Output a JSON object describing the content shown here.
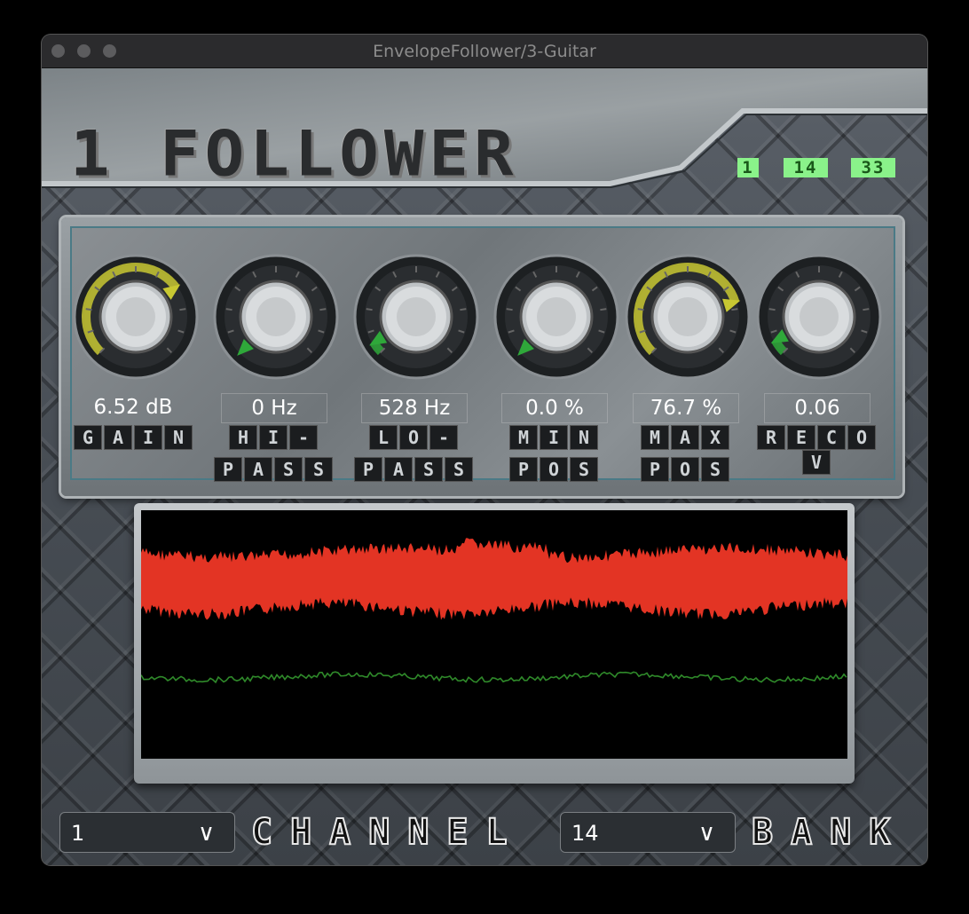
{
  "window": {
    "title": "EnvelopeFollower/3-Guitar"
  },
  "header": {
    "logo": "1 FOLLOWER",
    "lcd": [
      "1",
      "14",
      "33"
    ]
  },
  "knobs": [
    {
      "value": "6.52 dB",
      "label": [
        "GAIN"
      ],
      "level": 0.7,
      "color": "#c8c832"
    },
    {
      "value": "0 Hz",
      "label": [
        "HI-",
        "PASS"
      ],
      "level": 0.0,
      "color": "#2fa83a"
    },
    {
      "value": "528 Hz",
      "label": [
        "LO-",
        "PASS"
      ],
      "level": 0.05,
      "color": "#2fa83a"
    },
    {
      "value": "0.0 %",
      "label": [
        "MIN",
        "POS"
      ],
      "level": 0.0,
      "color": "#2fa83a"
    },
    {
      "value": "76.7 %",
      "label": [
        "MAX",
        "POS"
      ],
      "level": 0.77,
      "color": "#c8c832"
    },
    {
      "value": "0.06",
      "label": [
        "RECOV"
      ],
      "level": 0.06,
      "color": "#2fa83a"
    }
  ],
  "bottom": {
    "channel_value": "1",
    "channel_label": "CHANNEL",
    "bank_value": "14",
    "bank_label": "BANK"
  },
  "colors": {
    "signal": "#e33424",
    "envelope": "#2f8a2a"
  }
}
